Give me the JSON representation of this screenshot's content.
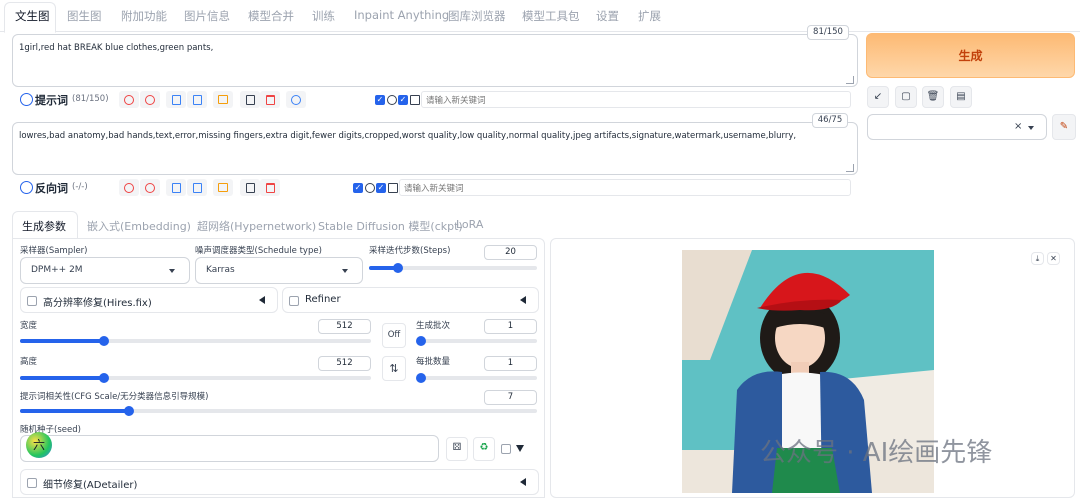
{
  "top_tabs": [
    "文生图",
    "图生图",
    "附加功能",
    "图片信息",
    "模型合并",
    "训练",
    "Inpaint Anything",
    "图库浏览器",
    "模型工具包",
    "设置",
    "扩展"
  ],
  "prompt": {
    "text": "1girl,red hat BREAK blue clothes,green pants,",
    "counter": "81/150",
    "label": "提示词",
    "count": "(81/150)",
    "keyword_placeholder": "请输入新关键词"
  },
  "negative": {
    "text": "lowres,bad anatomy,bad hands,text,error,missing fingers,extra digit,fewer digits,cropped,worst quality,low quality,normal quality,jpeg artifacts,signature,watermark,username,blurry,",
    "counter": "46/75",
    "label": "反向词",
    "count": "(-/-)",
    "keyword_placeholder": "请输入新关键词"
  },
  "generate_label": "生成",
  "style_select": {
    "value": "",
    "clear": "×"
  },
  "sub_tabs": [
    "生成参数",
    "嵌入式(Embedding)",
    "超网络(Hypernetwork)",
    "Stable Diffusion 模型(ckpt)",
    "LoRA"
  ],
  "params": {
    "sampler_label": "采样器(Sampler)",
    "sampler_value": "DPM++ 2M",
    "schedule_label": "噪声调度器类型(Schedule type)",
    "schedule_value": "Karras",
    "steps_label": "采样迭代步数(Steps)",
    "steps_value": "20",
    "steps_fraction": 0.17,
    "hires_label": "高分辨率修复(Hires.fix)",
    "refiner_label": "Refiner",
    "width_label": "宽度",
    "width_value": "512",
    "width_fraction": 0.24,
    "height_label": "高度",
    "height_value": "512",
    "height_fraction": 0.24,
    "off_label": "Off",
    "swap_icon": "⇅",
    "batch_count_label": "生成批次",
    "batch_count_value": "1",
    "batch_count_fraction": 0.0,
    "batch_size_label": "每批数量",
    "batch_size_value": "1",
    "batch_size_fraction": 0.0,
    "cfg_label": "提示词相关性(CFG Scale/无分类器信息引导规模)",
    "cfg_value": "7",
    "cfg_fraction": 0.21,
    "seed_label": "随机种子(seed)",
    "seed_value": "",
    "seed_badge": "六",
    "adetailer_label": "细节修复(ADetailer)"
  },
  "watermark": "公众号 · AI绘画先锋",
  "colors": {
    "accent": "#2563eb",
    "generate_bg": "#fdba74",
    "generate_text": "#c2410c"
  }
}
